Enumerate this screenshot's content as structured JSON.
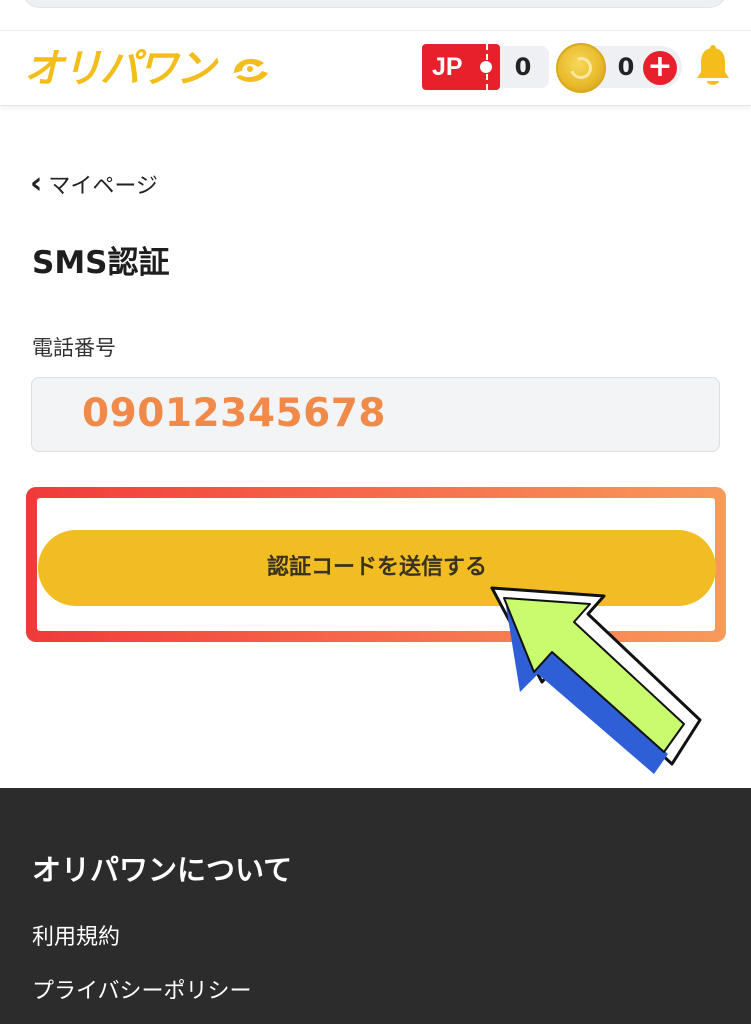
{
  "header": {
    "logo_text": "オリパワン",
    "jp_badge": "JP",
    "jp_count": "0",
    "coin_count": "0",
    "plus_label": "+"
  },
  "nav": {
    "back_label": "マイページ",
    "back_chevron": "‹"
  },
  "page": {
    "title": "SMS認証",
    "phone_label": "電話番号",
    "phone_value": "09012345678",
    "send_button_label": "認証コードを送信する"
  },
  "footer": {
    "title": "オリパワンについて",
    "links": [
      "利用規約",
      "プライバシーポリシー"
    ]
  },
  "colors": {
    "brand_yellow": "#f3bd1c",
    "button_yellow": "#f1bd22",
    "accent_red": "#e8202b",
    "phone_orange": "#f08a4b",
    "footer_bg": "#2c2c2c",
    "arrow_green": "#c8fb6e",
    "arrow_shadow_blue": "#2f5fd6"
  },
  "icons": {
    "back": "chevron-left-icon",
    "coin": "coin-icon",
    "plus": "plus-icon",
    "bell": "bell-icon",
    "pointer": "arrow-pointer-icon"
  }
}
